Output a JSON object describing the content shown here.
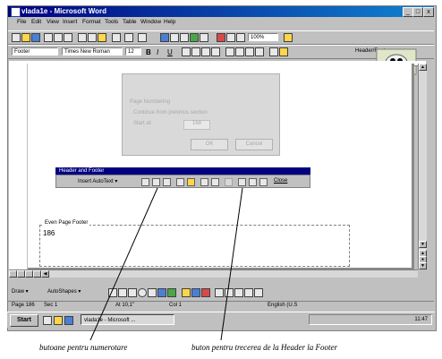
{
  "window": {
    "title": "vlada1e - Microsoft Word"
  },
  "menu": {
    "items": [
      "File",
      "Edit",
      "View",
      "Insert",
      "Format",
      "Tools",
      "Table",
      "Window",
      "Help"
    ]
  },
  "standard_toolbar": {
    "zoom": "100%"
  },
  "formatting_toolbar": {
    "style": "Footer",
    "font": "Times New Roman",
    "size": "12",
    "bold": "B",
    "italic": "I",
    "underline": "U",
    "header_footer_label": "Header/Footer"
  },
  "page_number_dialog": {
    "title": "Page Numbering",
    "option_continue": "Continue from previous section",
    "option_start": "Start at:",
    "start_value": "168",
    "ok": "OK",
    "cancel": "Cancel"
  },
  "header_footer_toolbar": {
    "title": "Header and Footer",
    "insert_autotext": "Insert AutoText ▾",
    "close": "Close"
  },
  "footer": {
    "label": "Even Page Footer",
    "value": "186"
  },
  "drawing_toolbar": {
    "draw": "Draw ▾",
    "autoshapes": "AutoShapes ▾"
  },
  "status_bar": {
    "page": "Page 186",
    "sec": "Sec 1",
    "at": "At 10,1\"",
    "col": "Col 1",
    "lang": "English (U.S"
  },
  "taskbar": {
    "start": "Start",
    "window_button": "vlada1e - Microsoft ...",
    "clock": "11:47"
  },
  "annotations": {
    "left": "butoane pentru numerotare",
    "right": "buton pentru trecerea de la Header la Footer"
  }
}
